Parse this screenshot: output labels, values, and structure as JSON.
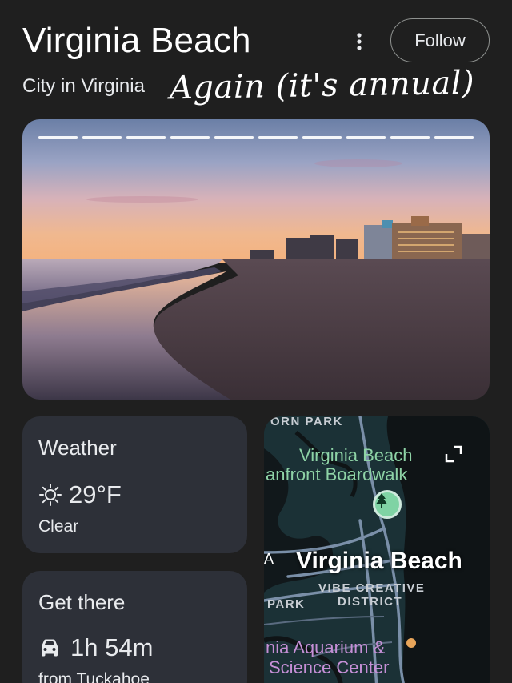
{
  "header": {
    "title": "Virginia Beach",
    "subtitle": "City in Virginia",
    "annotation": "Again (it's annual)",
    "follow_label": "Follow",
    "more_icon": "more-vert-icon"
  },
  "hero": {
    "story_segments": 10
  },
  "weather": {
    "title": "Weather",
    "temperature": "29°F",
    "condition": "Clear",
    "icon": "sun-icon"
  },
  "get_there": {
    "title": "Get there",
    "duration": "1h 54m",
    "from": "from Tuckahoe",
    "icon": "car-icon"
  },
  "map": {
    "labels": {
      "park_top": "ORN PARK",
      "boardwalk_line1": "Virginia Beach",
      "boardwalk_line2": "anfront Boardwalk",
      "city": "Virginia Beach",
      "city_prefix": "A",
      "district_line1": "VIBE CREATIVE",
      "district_line2": "DISTRICT",
      "park_left": "PARK",
      "aquarium_line1": "nia Aquarium &",
      "aquarium_line2": "Science Center"
    },
    "colors": {
      "land": "#1b3136",
      "road": "#7a8fa8",
      "green_label": "#8ed3a6",
      "pin": "#7fd3a4",
      "aquarium_dot": "#e8a55a"
    }
  },
  "colors": {
    "background": "#1f1f1f",
    "card": "#2d3038"
  }
}
